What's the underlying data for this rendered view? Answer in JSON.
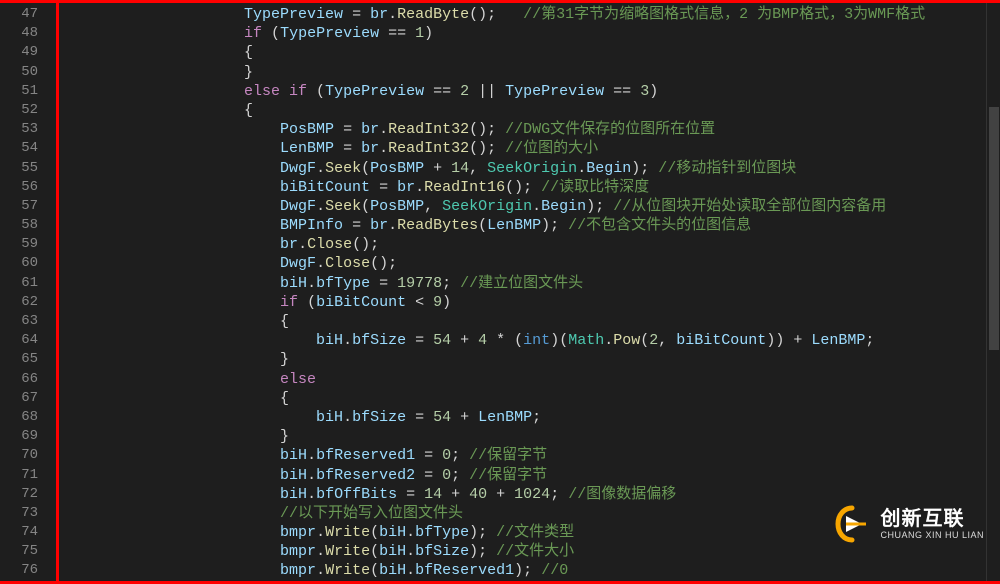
{
  "editor": {
    "line_start": 47,
    "line_end": 76,
    "scrollbar": {
      "thumb_top_pct": 18,
      "thumb_height_pct": 42
    },
    "lines": [
      {
        "n": 47,
        "indent": 5,
        "tokens": [
          [
            "fld",
            "TypePreview"
          ],
          [
            "pun",
            " = "
          ],
          [
            "fld",
            "br"
          ],
          [
            "pun",
            "."
          ],
          [
            "mth",
            "ReadByte"
          ],
          [
            "pun",
            "();   "
          ],
          [
            "cmt",
            "//第31字节为缩略图格式信息，2 为BMP格式，3为WMF格式"
          ]
        ]
      },
      {
        "n": 48,
        "indent": 5,
        "tokens": [
          [
            "ctrl",
            "if"
          ],
          [
            "pun",
            " ("
          ],
          [
            "fld",
            "TypePreview"
          ],
          [
            "pun",
            " == "
          ],
          [
            "num",
            "1"
          ],
          [
            "pun",
            ")"
          ]
        ]
      },
      {
        "n": 49,
        "indent": 5,
        "tokens": [
          [
            "pun",
            "{"
          ]
        ]
      },
      {
        "n": 50,
        "indent": 5,
        "tokens": [
          [
            "pun",
            "}"
          ]
        ]
      },
      {
        "n": 51,
        "indent": 5,
        "tokens": [
          [
            "ctrl",
            "else if"
          ],
          [
            "pun",
            " ("
          ],
          [
            "fld",
            "TypePreview"
          ],
          [
            "pun",
            " == "
          ],
          [
            "num",
            "2"
          ],
          [
            "pun",
            " || "
          ],
          [
            "fld",
            "TypePreview"
          ],
          [
            "pun",
            " == "
          ],
          [
            "num",
            "3"
          ],
          [
            "pun",
            ")"
          ]
        ]
      },
      {
        "n": 52,
        "indent": 5,
        "tokens": [
          [
            "pun",
            "{"
          ]
        ]
      },
      {
        "n": 53,
        "indent": 6,
        "tokens": [
          [
            "fld",
            "PosBMP"
          ],
          [
            "pun",
            " = "
          ],
          [
            "fld",
            "br"
          ],
          [
            "pun",
            "."
          ],
          [
            "mth",
            "ReadInt32"
          ],
          [
            "pun",
            "(); "
          ],
          [
            "cmt",
            "//DWG文件保存的位图所在位置"
          ]
        ]
      },
      {
        "n": 54,
        "indent": 6,
        "tokens": [
          [
            "fld",
            "LenBMP"
          ],
          [
            "pun",
            " = "
          ],
          [
            "fld",
            "br"
          ],
          [
            "pun",
            "."
          ],
          [
            "mth",
            "ReadInt32"
          ],
          [
            "pun",
            "(); "
          ],
          [
            "cmt",
            "//位图的大小"
          ]
        ]
      },
      {
        "n": 55,
        "indent": 6,
        "tokens": [
          [
            "fld",
            "DwgF"
          ],
          [
            "pun",
            "."
          ],
          [
            "mth",
            "Seek"
          ],
          [
            "pun",
            "("
          ],
          [
            "fld",
            "PosBMP"
          ],
          [
            "pun",
            " + "
          ],
          [
            "num",
            "14"
          ],
          [
            "pun",
            ", "
          ],
          [
            "type",
            "SeekOrigin"
          ],
          [
            "pun",
            "."
          ],
          [
            "fld",
            "Begin"
          ],
          [
            "pun",
            "); "
          ],
          [
            "cmt",
            "//移动指针到位图块"
          ]
        ]
      },
      {
        "n": 56,
        "indent": 6,
        "tokens": [
          [
            "fld",
            "biBitCount"
          ],
          [
            "pun",
            " = "
          ],
          [
            "fld",
            "br"
          ],
          [
            "pun",
            "."
          ],
          [
            "mth",
            "ReadInt16"
          ],
          [
            "pun",
            "(); "
          ],
          [
            "cmt",
            "//读取比特深度"
          ]
        ]
      },
      {
        "n": 57,
        "indent": 6,
        "tokens": [
          [
            "fld",
            "DwgF"
          ],
          [
            "pun",
            "."
          ],
          [
            "mth",
            "Seek"
          ],
          [
            "pun",
            "("
          ],
          [
            "fld",
            "PosBMP"
          ],
          [
            "pun",
            ", "
          ],
          [
            "type",
            "SeekOrigin"
          ],
          [
            "pun",
            "."
          ],
          [
            "fld",
            "Begin"
          ],
          [
            "pun",
            "); "
          ],
          [
            "cmt",
            "//从位图块开始处读取全部位图内容备用"
          ]
        ]
      },
      {
        "n": 58,
        "indent": 6,
        "tokens": [
          [
            "fld",
            "BMPInfo"
          ],
          [
            "pun",
            " = "
          ],
          [
            "fld",
            "br"
          ],
          [
            "pun",
            "."
          ],
          [
            "mth",
            "ReadBytes"
          ],
          [
            "pun",
            "("
          ],
          [
            "fld",
            "LenBMP"
          ],
          [
            "pun",
            "); "
          ],
          [
            "cmt",
            "//不包含文件头的位图信息"
          ]
        ]
      },
      {
        "n": 59,
        "indent": 6,
        "tokens": [
          [
            "fld",
            "br"
          ],
          [
            "pun",
            "."
          ],
          [
            "mth",
            "Close"
          ],
          [
            "pun",
            "();"
          ]
        ]
      },
      {
        "n": 60,
        "indent": 6,
        "tokens": [
          [
            "fld",
            "DwgF"
          ],
          [
            "pun",
            "."
          ],
          [
            "mth",
            "Close"
          ],
          [
            "pun",
            "();"
          ]
        ]
      },
      {
        "n": 61,
        "indent": 6,
        "tokens": [
          [
            "fld",
            "biH"
          ],
          [
            "pun",
            "."
          ],
          [
            "fld",
            "bfType"
          ],
          [
            "pun",
            " = "
          ],
          [
            "num",
            "19778"
          ],
          [
            "pun",
            "; "
          ],
          [
            "cmt",
            "//建立位图文件头"
          ]
        ]
      },
      {
        "n": 62,
        "indent": 6,
        "tokens": [
          [
            "ctrl",
            "if"
          ],
          [
            "pun",
            " ("
          ],
          [
            "fld",
            "biBitCount"
          ],
          [
            "pun",
            " < "
          ],
          [
            "num",
            "9"
          ],
          [
            "pun",
            ")"
          ]
        ]
      },
      {
        "n": 63,
        "indent": 6,
        "tokens": [
          [
            "pun",
            "{"
          ]
        ]
      },
      {
        "n": 64,
        "indent": 7,
        "tokens": [
          [
            "fld",
            "biH"
          ],
          [
            "pun",
            "."
          ],
          [
            "fld",
            "bfSize"
          ],
          [
            "pun",
            " = "
          ],
          [
            "num",
            "54"
          ],
          [
            "pun",
            " + "
          ],
          [
            "num",
            "4"
          ],
          [
            "pun",
            " * ("
          ],
          [
            "kw",
            "int"
          ],
          [
            "pun",
            ")("
          ],
          [
            "type",
            "Math"
          ],
          [
            "pun",
            "."
          ],
          [
            "mth",
            "Pow"
          ],
          [
            "pun",
            "("
          ],
          [
            "num",
            "2"
          ],
          [
            "pun",
            ", "
          ],
          [
            "fld",
            "biBitCount"
          ],
          [
            "pun",
            ")) + "
          ],
          [
            "fld",
            "LenBMP"
          ],
          [
            "pun",
            ";"
          ]
        ]
      },
      {
        "n": 65,
        "indent": 6,
        "tokens": [
          [
            "pun",
            "}"
          ]
        ]
      },
      {
        "n": 66,
        "indent": 6,
        "tokens": [
          [
            "ctrl",
            "else"
          ]
        ]
      },
      {
        "n": 67,
        "indent": 6,
        "tokens": [
          [
            "pun",
            "{"
          ]
        ]
      },
      {
        "n": 68,
        "indent": 7,
        "tokens": [
          [
            "fld",
            "biH"
          ],
          [
            "pun",
            "."
          ],
          [
            "fld",
            "bfSize"
          ],
          [
            "pun",
            " = "
          ],
          [
            "num",
            "54"
          ],
          [
            "pun",
            " + "
          ],
          [
            "fld",
            "LenBMP"
          ],
          [
            "pun",
            ";"
          ]
        ]
      },
      {
        "n": 69,
        "indent": 6,
        "tokens": [
          [
            "pun",
            "}"
          ]
        ]
      },
      {
        "n": 70,
        "indent": 6,
        "tokens": [
          [
            "fld",
            "biH"
          ],
          [
            "pun",
            "."
          ],
          [
            "fld",
            "bfReserved1"
          ],
          [
            "pun",
            " = "
          ],
          [
            "num",
            "0"
          ],
          [
            "pun",
            "; "
          ],
          [
            "cmt",
            "//保留字节"
          ]
        ]
      },
      {
        "n": 71,
        "indent": 6,
        "tokens": [
          [
            "fld",
            "biH"
          ],
          [
            "pun",
            "."
          ],
          [
            "fld",
            "bfReserved2"
          ],
          [
            "pun",
            " = "
          ],
          [
            "num",
            "0"
          ],
          [
            "pun",
            "; "
          ],
          [
            "cmt",
            "//保留字节"
          ]
        ]
      },
      {
        "n": 72,
        "indent": 6,
        "tokens": [
          [
            "fld",
            "biH"
          ],
          [
            "pun",
            "."
          ],
          [
            "fld",
            "bfOffBits"
          ],
          [
            "pun",
            " = "
          ],
          [
            "num",
            "14"
          ],
          [
            "pun",
            " + "
          ],
          [
            "num",
            "40"
          ],
          [
            "pun",
            " + "
          ],
          [
            "num",
            "1024"
          ],
          [
            "pun",
            "; "
          ],
          [
            "cmt",
            "//图像数据偏移"
          ]
        ]
      },
      {
        "n": 73,
        "indent": 6,
        "tokens": [
          [
            "cmt",
            "//以下开始写入位图文件头"
          ]
        ]
      },
      {
        "n": 74,
        "indent": 6,
        "tokens": [
          [
            "fld",
            "bmpr"
          ],
          [
            "pun",
            "."
          ],
          [
            "mth",
            "Write"
          ],
          [
            "pun",
            "("
          ],
          [
            "fld",
            "biH"
          ],
          [
            "pun",
            "."
          ],
          [
            "fld",
            "bfType"
          ],
          [
            "pun",
            "); "
          ],
          [
            "cmt",
            "//文件类型"
          ]
        ]
      },
      {
        "n": 75,
        "indent": 6,
        "tokens": [
          [
            "fld",
            "bmpr"
          ],
          [
            "pun",
            "."
          ],
          [
            "mth",
            "Write"
          ],
          [
            "pun",
            "("
          ],
          [
            "fld",
            "biH"
          ],
          [
            "pun",
            "."
          ],
          [
            "fld",
            "bfSize"
          ],
          [
            "pun",
            "); "
          ],
          [
            "cmt",
            "//文件大小"
          ]
        ]
      },
      {
        "n": 76,
        "indent": 6,
        "tokens": [
          [
            "fld",
            "bmpr"
          ],
          [
            "pun",
            "."
          ],
          [
            "mth",
            "Write"
          ],
          [
            "pun",
            "("
          ],
          [
            "fld",
            "biH"
          ],
          [
            "pun",
            "."
          ],
          [
            "fld",
            "bfReserved1"
          ],
          [
            "pun",
            "); "
          ],
          [
            "cmt",
            "//0"
          ]
        ]
      }
    ]
  },
  "watermark": {
    "cn": "创新互联",
    "en": "CHUANG XIN HU LIAN"
  }
}
